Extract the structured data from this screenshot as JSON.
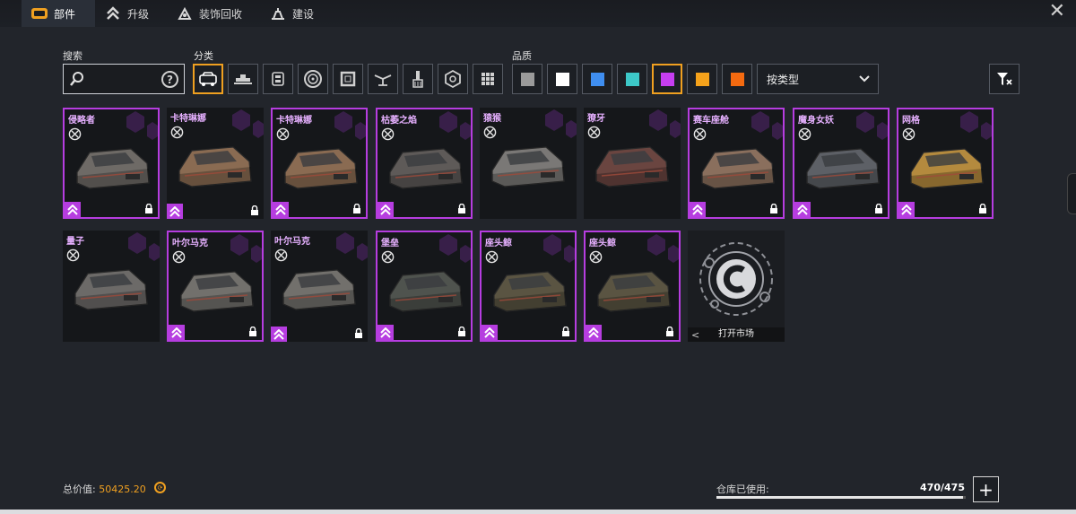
{
  "tabs": [
    {
      "label": "部件",
      "icon": "parts-icon",
      "active": true
    },
    {
      "label": "升级",
      "icon": "upgrade-chevrons-icon",
      "active": false
    },
    {
      "label": "装饰回收",
      "icon": "recycle-icon",
      "active": false
    },
    {
      "label": "建设",
      "icon": "build-icon",
      "active": false
    }
  ],
  "labels": {
    "search": "搜索",
    "category": "分类",
    "quality": "品质"
  },
  "search": {
    "value": "",
    "placeholder": ""
  },
  "categories": [
    {
      "icon": "cabin-icon",
      "selected": true
    },
    {
      "icon": "weapon-icon",
      "selected": false
    },
    {
      "icon": "module-icon",
      "selected": false
    },
    {
      "icon": "wheel-icon",
      "selected": false
    },
    {
      "icon": "frame-icon",
      "selected": false
    },
    {
      "icon": "drone-icon",
      "selected": false
    },
    {
      "icon": "paint-brush-icon",
      "selected": false
    },
    {
      "icon": "decor-icon",
      "selected": false
    },
    {
      "icon": "grid-icon",
      "selected": false
    }
  ],
  "qualities": [
    {
      "color": "#9a9a9a",
      "selected": false
    },
    {
      "color": "#ffffff",
      "selected": false
    },
    {
      "color": "#3f8ef0",
      "selected": false
    },
    {
      "color": "#3dc8c8",
      "selected": false
    },
    {
      "color": "#c63ef0",
      "selected": true
    },
    {
      "color": "#f5a21b",
      "selected": false
    },
    {
      "color": "#f46a10",
      "selected": false
    }
  ],
  "sort": {
    "selected": "按类型"
  },
  "items": [
    {
      "name": "侵略者",
      "rarity": "purple",
      "locked": true,
      "body": "#6e6a66"
    },
    {
      "name": "卡特琳娜",
      "rarity": "none",
      "locked": true,
      "body": "#8a6b52"
    },
    {
      "name": "卡特琳娜",
      "rarity": "purple",
      "locked": true,
      "body": "#8a6b52"
    },
    {
      "name": "枯萎之焰",
      "rarity": "purple",
      "locked": true,
      "body": "#5e5a58"
    },
    {
      "name": "猿猴",
      "rarity": "none",
      "locked": false,
      "body": "#7a7876"
    },
    {
      "name": "獠牙",
      "rarity": "none",
      "locked": false,
      "body": "#6a4540"
    },
    {
      "name": "赛车座舱",
      "rarity": "purple",
      "locked": true,
      "body": "#8a6f5d"
    },
    {
      "name": "魔身女妖",
      "rarity": "purple",
      "locked": true,
      "body": "#5d6066"
    },
    {
      "name": "网格",
      "rarity": "purple",
      "locked": true,
      "body": "#b48a3e"
    },
    {
      "name": "量子",
      "rarity": "none",
      "locked": false,
      "body": "#6c6a68"
    },
    {
      "name": "叶尔马克",
      "rarity": "purple",
      "locked": true,
      "body": "#72706c"
    },
    {
      "name": "叶尔马克",
      "rarity": "none",
      "locked": true,
      "body": "#72706c"
    },
    {
      "name": "堡垒",
      "rarity": "purple",
      "locked": true,
      "body": "#4f534e"
    },
    {
      "name": "座头鲸",
      "rarity": "purple",
      "locked": true,
      "body": "#5a5442"
    },
    {
      "name": "座头鲸",
      "rarity": "purple",
      "locked": true,
      "body": "#5a5442"
    }
  ],
  "market": {
    "label": "打开市场"
  },
  "footer": {
    "total_label": "总价值:",
    "total_value": "50425.20",
    "storage_label": "仓库已使用:",
    "storage_value": "470/475",
    "storage_fraction": 0.9895
  },
  "close_label": "✕",
  "plus_label": "+"
}
